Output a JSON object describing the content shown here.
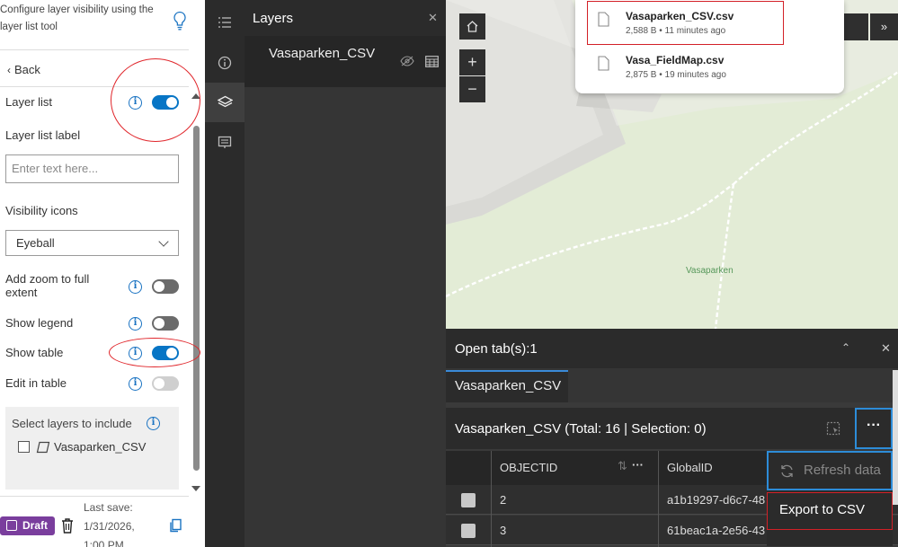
{
  "settings": {
    "hint": "Configure layer visibility using the layer list tool",
    "back": "Back",
    "layer_list": "Layer list",
    "layer_list_label": "Layer list label",
    "input_placeholder": "Enter text here...",
    "visibility_icons": "Visibility icons",
    "visibility_value": "Eyeball",
    "add_zoom": "Add zoom to full extent",
    "show_legend": "Show legend",
    "show_table": "Show table",
    "edit_in_table": "Edit in table",
    "select_layers": "Select layers to include",
    "layer_item": "Vasaparken_CSV",
    "toggles": {
      "layer_list": true,
      "add_zoom": false,
      "show_legend": false,
      "show_table": true,
      "edit_in_table": false
    },
    "draft": "Draft",
    "last_save": "Last save: 1/31/2026, 1:00 PM"
  },
  "layers_panel": {
    "title": "Layers",
    "close": "✕",
    "item": "Vasaparken_CSV"
  },
  "map": {
    "zoom_in": "+",
    "zoom_out": "−",
    "expand": "»",
    "label": "Vasaparken",
    "files": [
      {
        "name": "Vasaparken_CSV.csv",
        "meta": "2,588 B • 11 minutes ago"
      },
      {
        "name": "Vasa_FieldMap.csv",
        "meta": "2,875 B • 19 minutes ago"
      }
    ]
  },
  "table": {
    "open_tabs": "Open tab(s):1",
    "tab": "Vasaparken_CSV",
    "title": "Vasaparken_CSV (Total: 16 | Selection: 0)",
    "more": "···",
    "columns": [
      "OBJECTID",
      "GlobalID"
    ],
    "rows": [
      {
        "objectid": "2",
        "globalid": "a1b19297-d6c7-48"
      },
      {
        "objectid": "3",
        "globalid": "61beac1a-2e56-43"
      }
    ],
    "menu": {
      "refresh": "Refresh data",
      "export": "Export to CSV"
    }
  },
  "colors": {
    "accent": "#0775c5",
    "draft": "#7a3e9d",
    "highlight": "#d32027",
    "map": "#e3ecd6"
  }
}
